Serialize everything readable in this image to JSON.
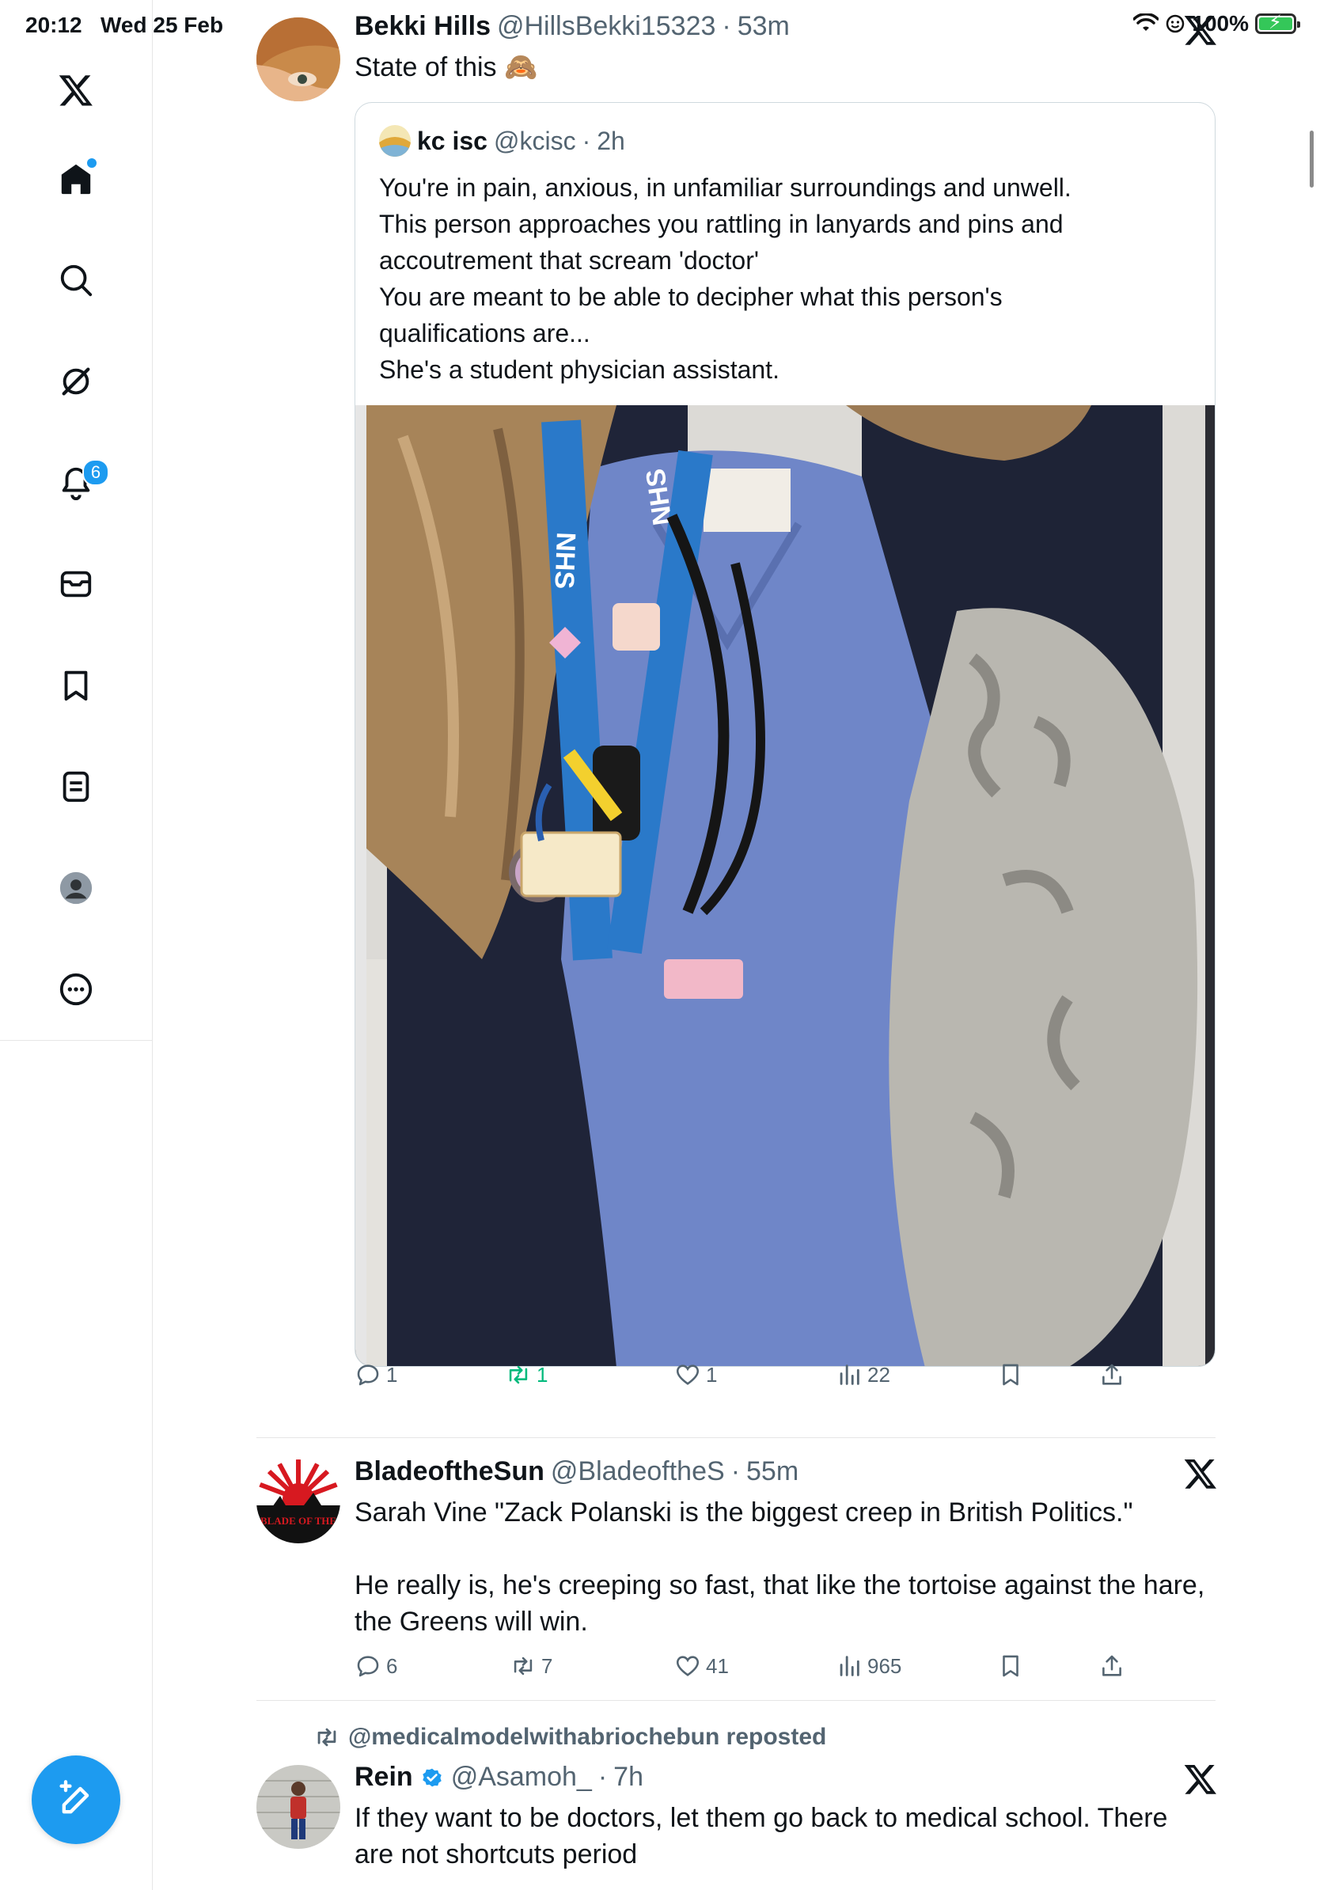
{
  "status_bar": {
    "time": "20:12",
    "date": "Wed 25 Feb",
    "battery": "100%",
    "icons": [
      "wifi-icon",
      "focus-icon",
      "battery-charging-icon"
    ]
  },
  "sidebar": {
    "items": [
      {
        "name": "x-logo",
        "icon": "x-logo-icon"
      },
      {
        "name": "home",
        "icon": "home-icon",
        "active": true
      },
      {
        "name": "explore",
        "icon": "search-icon"
      },
      {
        "name": "grok",
        "icon": "grok-icon"
      },
      {
        "name": "notifications",
        "icon": "bell-icon",
        "badge": "6"
      },
      {
        "name": "messages",
        "icon": "mail-icon"
      },
      {
        "name": "bookmarks",
        "icon": "bookmark-icon"
      },
      {
        "name": "lists",
        "icon": "list-icon"
      },
      {
        "name": "profile",
        "icon": "profile-icon"
      },
      {
        "name": "more",
        "icon": "more-icon"
      }
    ],
    "compose_icon": "compose-icon"
  },
  "tweets": [
    {
      "name": "Bekki Hills",
      "handle": "@HillsBekki15323",
      "time": "53m",
      "text": "State of this 🙈",
      "quote": {
        "name": "kc isc",
        "handle": "@kcisc",
        "time": "2h",
        "lines": [
          "You're in pain, anxious, in unfamiliar surroundings and unwell.",
          "This person approaches you rattling in lanyards and pins and",
          "accoutrement that scream 'doctor'",
          "You are meant to be able to decipher what this person's",
          "qualifications are...",
          "She's a student physician assistant."
        ],
        "lanyard_text": "NHS"
      },
      "actions": {
        "replies": "1",
        "reposts": "1",
        "likes": "1",
        "views": "22"
      }
    },
    {
      "name": "BladeoftheSun",
      "handle": "@BladeoftheS",
      "time": "55m",
      "avatar_text": "BLADE OF THE",
      "lines": [
        "Sarah Vine \"Zack Polanski is the biggest creep in British Politics.\"",
        "",
        "He really is, he's creeping so fast, that like the tortoise against the hare,",
        "the Greens will win."
      ],
      "actions": {
        "replies": "6",
        "reposts": "7",
        "likes": "41",
        "views": "965"
      }
    },
    {
      "reposted_by": "@medicalmodelwithabriochebun reposted",
      "name": "Rein",
      "handle": "@Asamoh_",
      "time": "7h",
      "verified": true,
      "lines": [
        "If they want to be doctors, let them go back to medical school. There",
        "are not shortcuts period"
      ]
    }
  ],
  "colors": {
    "accent": "#1d9bf0",
    "repost_active": "#00ba7c",
    "text": "#0f1419",
    "secondary": "#536471"
  }
}
